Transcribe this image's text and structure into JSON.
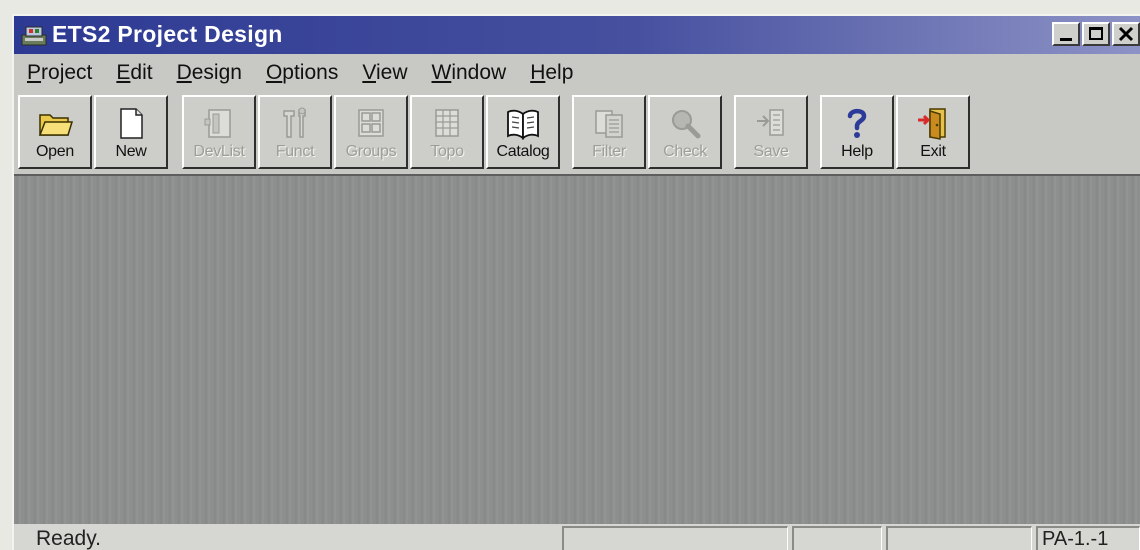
{
  "window": {
    "title": "ETS2 Project Design",
    "title_icon": "app-icon",
    "controls": [
      "minimize-icon",
      "maximize-icon",
      "close-icon"
    ]
  },
  "menu": {
    "items": [
      {
        "label": "Project",
        "accel": "P",
        "rest": "roject"
      },
      {
        "label": "Edit",
        "accel": "E",
        "rest": "dit"
      },
      {
        "label": "Design",
        "accel": "D",
        "rest": "esign"
      },
      {
        "label": "Options",
        "accel": "O",
        "rest": "ptions"
      },
      {
        "label": "View",
        "accel": "V",
        "rest": "iew"
      },
      {
        "label": "Window",
        "accel": "W",
        "rest": "indow"
      },
      {
        "label": "Help",
        "accel": "H",
        "rest": "elp"
      }
    ]
  },
  "toolbar": {
    "buttons": [
      {
        "label": "Open",
        "icon": "folder-icon",
        "enabled": true
      },
      {
        "label": "New",
        "icon": "new-document-icon",
        "enabled": true
      },
      {
        "label": "DevList",
        "icon": "device-list-icon",
        "enabled": false
      },
      {
        "label": "Funct",
        "icon": "tools-icon",
        "enabled": false
      },
      {
        "label": "Groups",
        "icon": "groups-icon",
        "enabled": false
      },
      {
        "label": "Topo",
        "icon": "topology-icon",
        "enabled": false
      },
      {
        "label": "Catalog",
        "icon": "book-icon",
        "enabled": true
      },
      {
        "label": "Filter",
        "icon": "filter-icon",
        "enabled": false
      },
      {
        "label": "Check",
        "icon": "magnifier-icon",
        "enabled": false
      },
      {
        "label": "Save",
        "icon": "save-icon",
        "enabled": false
      },
      {
        "label": "Help",
        "icon": "help-icon",
        "enabled": true
      },
      {
        "label": "Exit",
        "icon": "exit-door-icon",
        "enabled": true
      }
    ]
  },
  "statusbar": {
    "text": "Ready.",
    "panels": [
      "",
      "",
      "",
      "PA-1.-1"
    ]
  },
  "colors": {
    "titlebar_start": "#2d3a93",
    "titlebar_end": "#8d93c6",
    "workspace": "#8f9190",
    "chrome": "#c8c8c4"
  }
}
